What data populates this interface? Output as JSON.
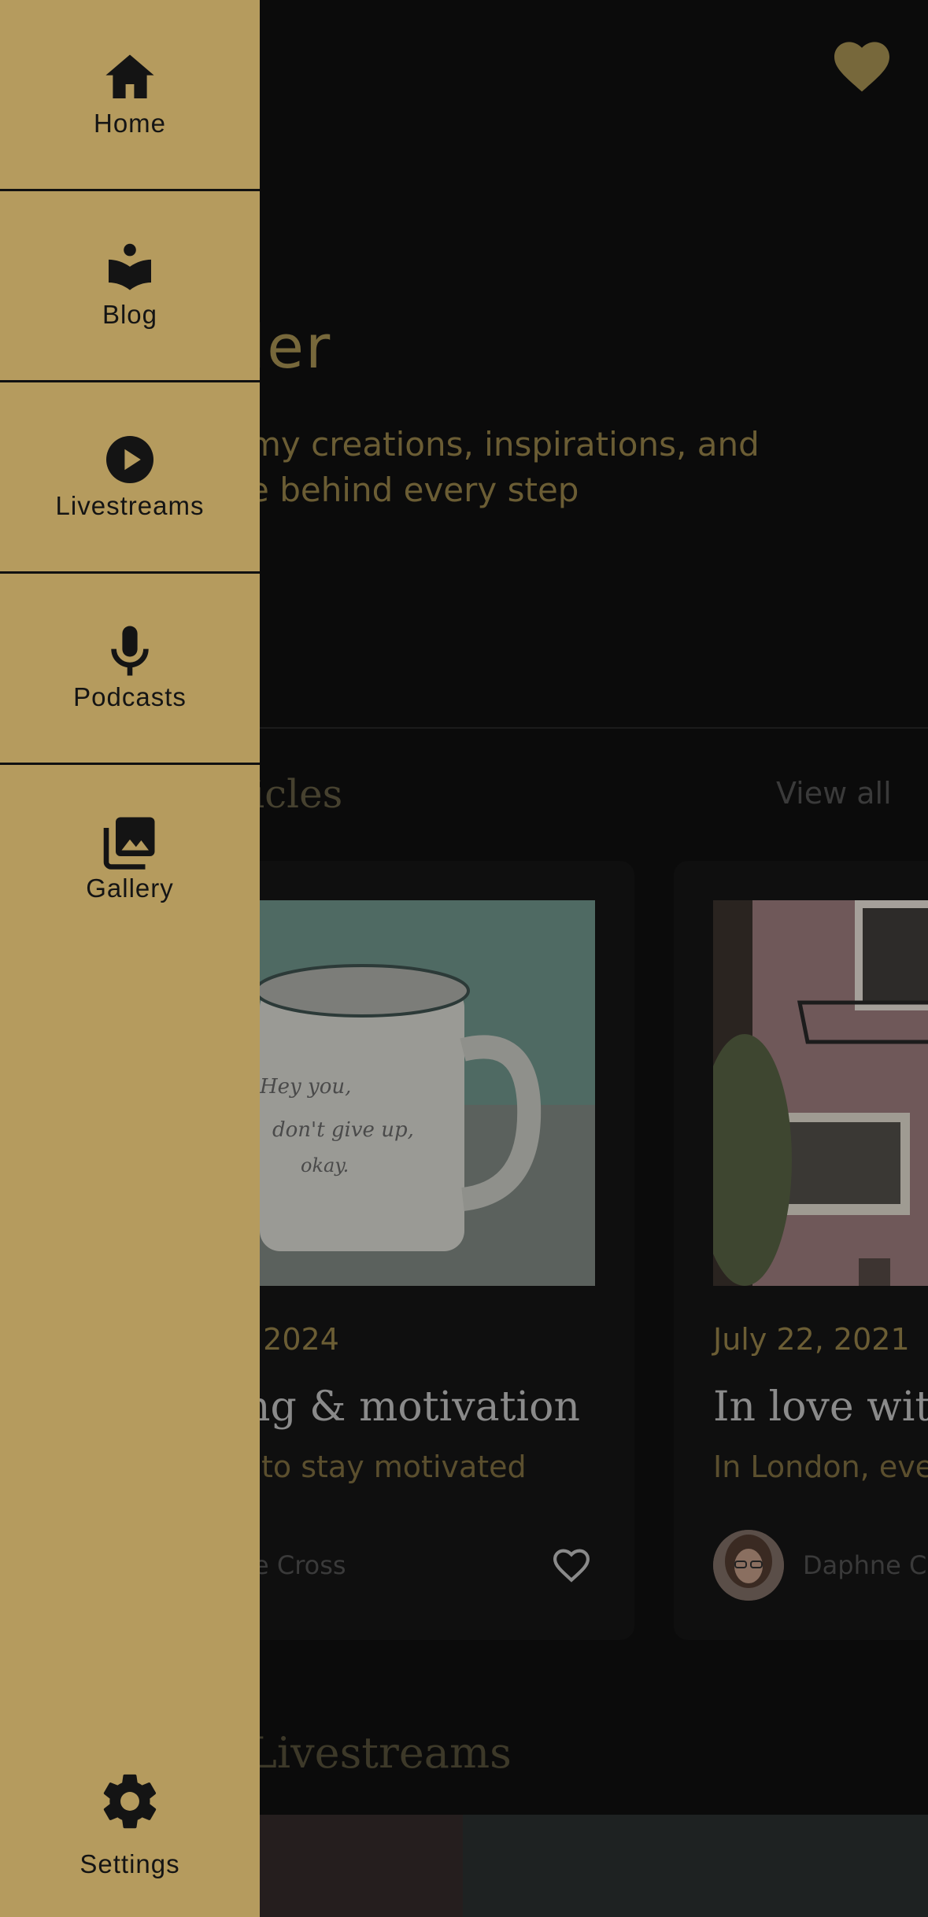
{
  "header": {
    "favorite_icon": "heart-icon"
  },
  "hero": {
    "title_fragment": "Butler",
    "description_line1": "my creations, inspirations, and",
    "description_line2": "e behind every step"
  },
  "articles": {
    "section_title_fragment": "ticles",
    "view_all_label": "View all",
    "cards": [
      {
        "date_fragment": ", 2024",
        "title_fragment": "ng & motivation",
        "description_fragment": "to stay motivated",
        "author_fragment": "e Cross",
        "image_text_line1": "Hey you,",
        "image_text_line2": "don't give up,",
        "image_text_line3": "okay.",
        "like_icon": "heart-outline-icon"
      },
      {
        "date": "July 22, 2021",
        "title_fragment": "In love with",
        "description_fragment": "In London, eve",
        "author_fragment": "Daphne C"
      }
    ]
  },
  "livestreams": {
    "section_title_fragment": "Livestreams"
  },
  "drawer": {
    "items": [
      {
        "label": "Home",
        "icon": "home-icon"
      },
      {
        "label": "Blog",
        "icon": "book-reader-icon"
      },
      {
        "label": "Livestreams",
        "icon": "play-circle-icon"
      },
      {
        "label": "Podcasts",
        "icon": "microphone-icon"
      },
      {
        "label": "Gallery",
        "icon": "photo-library-icon"
      }
    ],
    "settings": {
      "label": "Settings",
      "icon": "gear-icon"
    }
  },
  "colors": {
    "drawer_background": "#b59b5e",
    "page_background": "#0b0b0b",
    "accent_dimmed": "#77683b"
  }
}
